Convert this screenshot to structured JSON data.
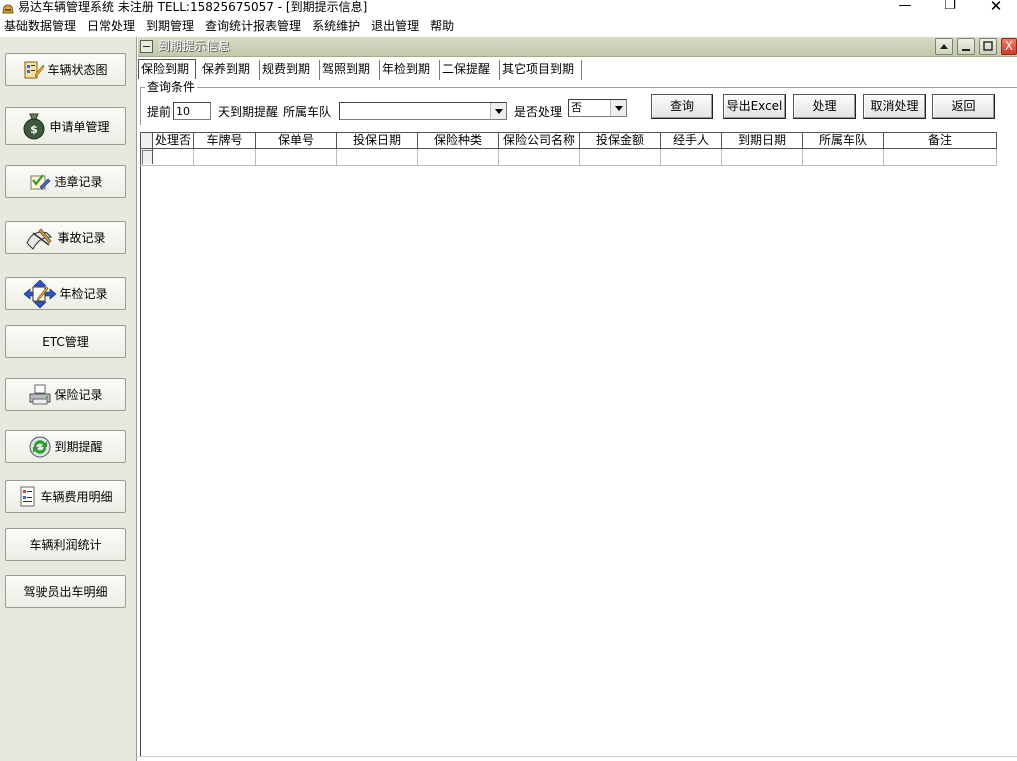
{
  "window": {
    "title": "易达车辆管理系统 未注册 TELL:15825675057 - [到期提示信息]",
    "min_glyph": "—",
    "max_glyph": "❐",
    "close_glyph": "✕"
  },
  "menu": [
    "基础数据管理",
    "日常处理",
    "到期管理",
    "查询统计报表管理",
    "系统维护",
    "退出管理",
    "帮助"
  ],
  "sidebar": {
    "items": [
      {
        "label": "车辆状态图",
        "icon": "vehicle-status-icon"
      },
      {
        "label": "申请单管理",
        "icon": "money-bag-icon"
      },
      {
        "label": "违章记录",
        "icon": "violation-icon"
      },
      {
        "label": "事故记录",
        "icon": "accident-icon"
      },
      {
        "label": "年检记录",
        "icon": "inspection-icon"
      },
      {
        "label": "ETC管理",
        "icon": ""
      },
      {
        "label": "保险记录",
        "icon": "printer-icon"
      },
      {
        "label": "到期提醒",
        "icon": "refresh-icon"
      },
      {
        "label": "车辆费用明细",
        "icon": "document-icon"
      },
      {
        "label": "车辆利润统计",
        "icon": ""
      },
      {
        "label": "驾驶员出车明细",
        "icon": ""
      }
    ]
  },
  "child_window": {
    "title": "到期提示信息",
    "close_glyph": "X"
  },
  "tabs": [
    "保险到期",
    "保养到期",
    "规费到期",
    "驾照到期",
    "年检到期",
    "二保提醒",
    "其它项目到期"
  ],
  "query": {
    "group_label": "查询条件",
    "prefix_label": "提前",
    "days_value": "10",
    "suffix_label": "天到期提醒",
    "team_label": "所属车队",
    "team_value": "",
    "processed_label": "是否处理",
    "processed_value": "否"
  },
  "buttons": {
    "query": "查询",
    "export": "导出Excel",
    "process": "处理",
    "cancel_process": "取消处理",
    "back": "返回"
  },
  "grid": {
    "columns": [
      "处理否",
      "车牌号",
      "保单号",
      "投保日期",
      "保险种类",
      "保险公司名称",
      "投保金额",
      "经手人",
      "到期日期",
      "所属车队",
      "备注"
    ]
  }
}
